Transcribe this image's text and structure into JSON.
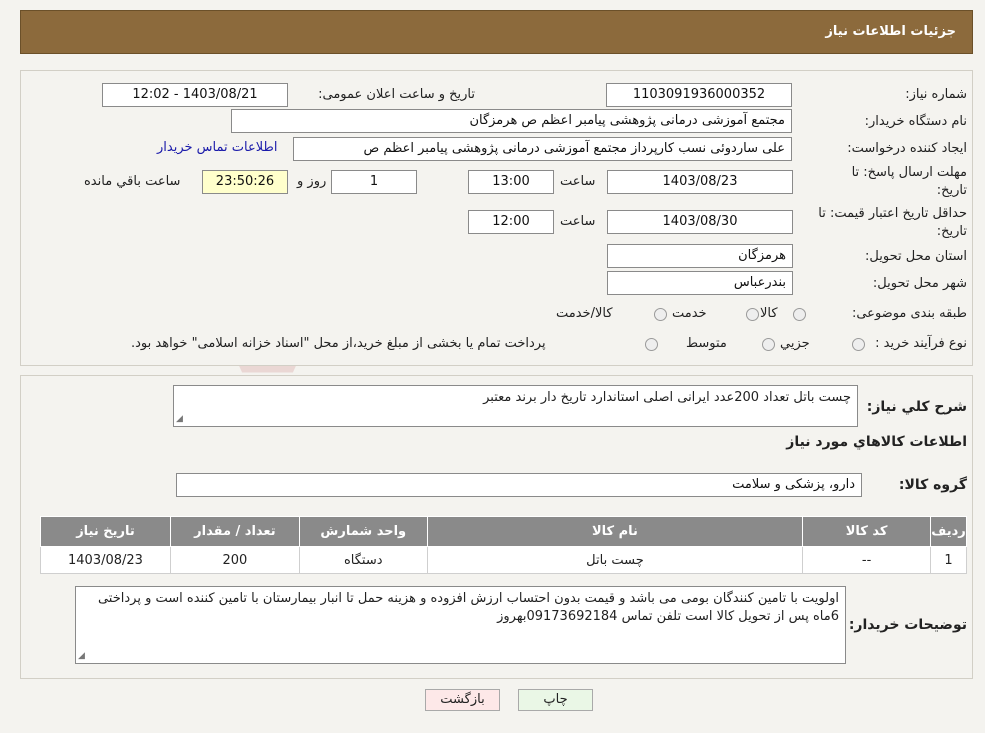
{
  "header": {
    "title": "جزئیات اطلاعات نیاز"
  },
  "fields": {
    "need_number_label": "شماره نیاز:",
    "need_number": "1103091936000352",
    "announce_label": "تاریخ و ساعت اعلان عمومی:",
    "announce_value": "1403/08/21 - 12:02",
    "buyer_org_label": "نام دستگاه خریدار:",
    "buyer_org": "مجتمع آموزشی درمانی پژوهشی پیامبر اعظم ص  هرمزگان",
    "creator_label": "ایجاد کننده درخواست:",
    "creator": "علی ساردوئی نسب کارپرداز مجتمع آموزشی درمانی پژوهشی پیامبر اعظم ص",
    "contact_link": "اطلاعات تماس خریدار",
    "deadline_label_1": "مهلت ارسال پاسخ: تا",
    "deadline_label_2": "تاریخ:",
    "deadline_date": "1403/08/23",
    "time_label": "ساعت",
    "deadline_time": "13:00",
    "days_value": "1",
    "days_label": "روز و",
    "remaining_time": "23:50:26",
    "remaining_label": "ساعت باقي مانده",
    "validity_label_1": "حداقل تاریخ اعتبار قیمت: تا",
    "validity_label_2": "تاریخ:",
    "validity_date": "1403/08/30",
    "validity_time": "12:00",
    "province_label": "استان محل تحویل:",
    "province": "هرمزگان",
    "city_label": "شهر محل تحویل:",
    "city": "بندرعباس",
    "category_label": "طبقه بندی موضوعی:",
    "category_options": [
      "کالا",
      "خدمت",
      "کالا/خدمت"
    ],
    "process_label": "نوع فرآیند خرید :",
    "process_options": [
      "جزیي",
      "متوسط"
    ],
    "process_note": "پرداخت تمام یا بخشی از مبلغ خرید،از محل \"اسناد خزانه اسلامی\" خواهد بود."
  },
  "description": {
    "label": "شرح کلي نياز:",
    "text": "چست باتل تعداد 200عدد  ایرانی  اصلی  استاندارد  تاریخ  دار  برند  معتبر"
  },
  "goods": {
    "section_title": "اطلاعات کالاهاي مورد نياز",
    "group_label": "گروه کالا:",
    "group_value": "دارو، پزشکی و سلامت",
    "columns": [
      "ردیف",
      "کد کالا",
      "نام کالا",
      "واحد شمارش",
      "تعداد / مقدار",
      "تاریخ نیاز"
    ],
    "rows": [
      {
        "index": "1",
        "code": "--",
        "name": "چست باتل",
        "unit": "دستگاه",
        "qty": "200",
        "date": "1403/08/23"
      }
    ]
  },
  "buyer_notes": {
    "label": "توضیحات خریدار:",
    "text": "اولویت با تامین کنندگان بومی می باشد و قیمت بدون احتساب ارزش افزوده و هزینه حمل تا انبار بیمارستان با تامین کننده است و پرداختی 6ماه پس از تحویل کالا است تلفن تماس 09173692184بهروز"
  },
  "buttons": {
    "print": "چاپ",
    "back": "بازگشت"
  },
  "colors": {
    "header_bg": "#8c6a3c",
    "table_header_bg": "#8a8a8a",
    "highlight_yellow": "#ffffcc",
    "back_button_bg": "#fde8e8",
    "print_button_bg": "#eaf7e6",
    "link": "#1a1aaa"
  }
}
